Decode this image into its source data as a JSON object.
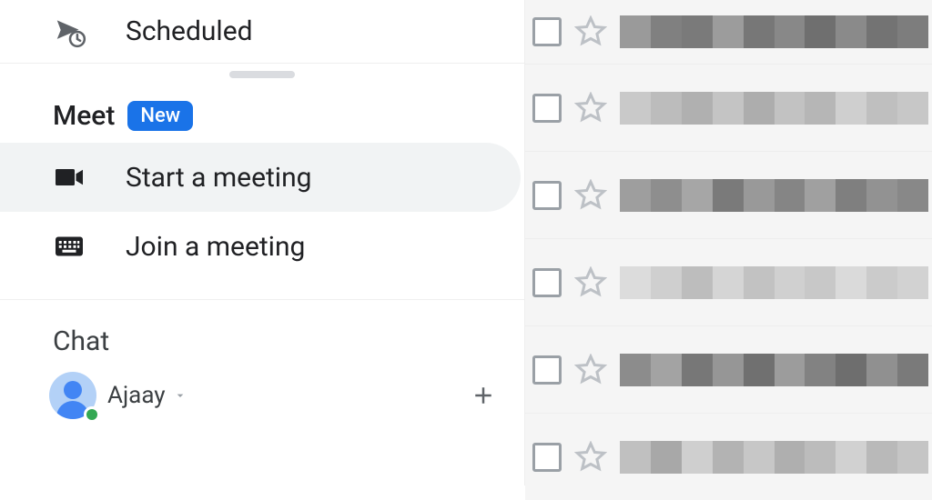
{
  "sidebar": {
    "scheduled_label": "Scheduled",
    "meet": {
      "title": "Meet",
      "badge": "New",
      "start_label": "Start a meeting",
      "join_label": "Join a meeting"
    },
    "chat": {
      "title": "Chat",
      "user_name": "Ajaay"
    }
  },
  "inbox": {
    "rows": 6
  }
}
